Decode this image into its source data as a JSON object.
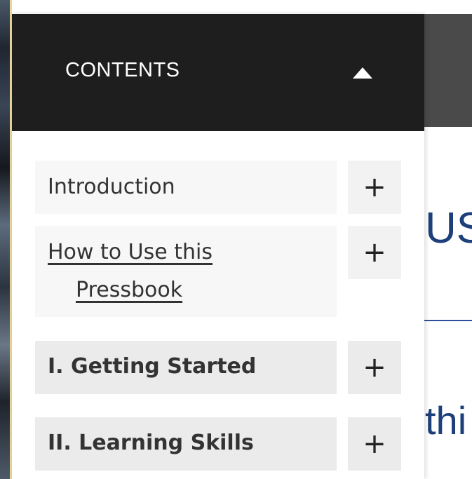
{
  "panel": {
    "title": "CONTENTS",
    "toggle_icon": "triangle-up-icon"
  },
  "toc": [
    {
      "label": "Introduction",
      "is_link": false,
      "bold": false,
      "expand": "+"
    },
    {
      "label_line1": "How to Use this",
      "label_line2": "Pressbook",
      "is_link": true,
      "bold": false,
      "expand": "+"
    },
    {
      "label": "I. Getting Started",
      "is_link": false,
      "bold": true,
      "expand": "+"
    },
    {
      "label": "II. Learning Skills",
      "is_link": false,
      "bold": true,
      "expand": "+"
    }
  ],
  "background": {
    "heading_fragment": "US",
    "subheading_fragment": "thi"
  },
  "colors": {
    "header_bg": "#1e1e1e",
    "heading_blue": "#1d3f7a",
    "row_light": "#f7f7f7",
    "row_dark": "#ebebeb"
  }
}
